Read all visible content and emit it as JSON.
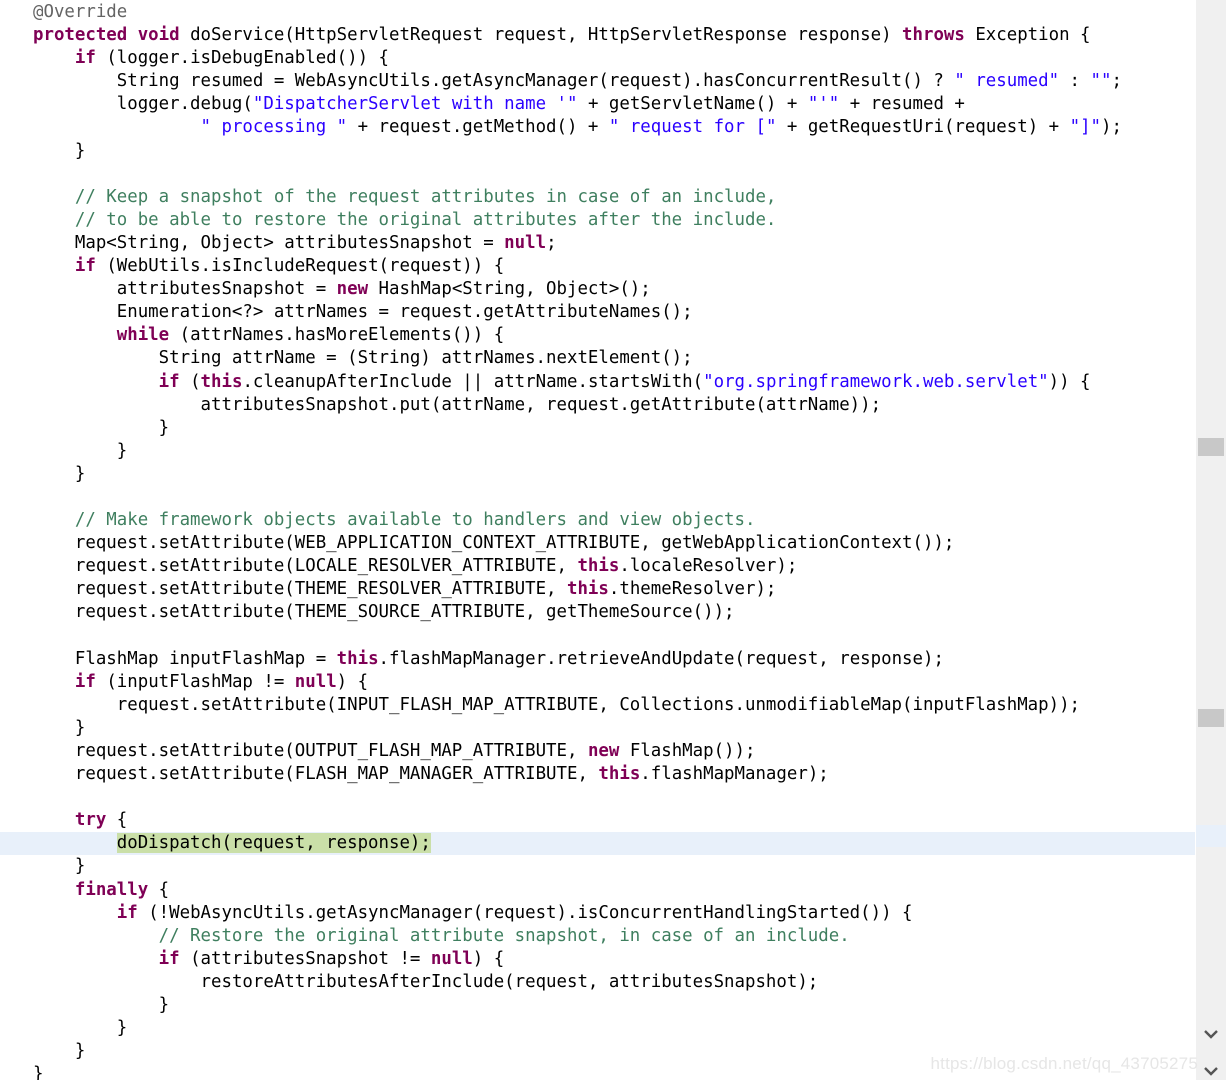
{
  "editor": {
    "language": "java",
    "colors": {
      "background": "#ffffff",
      "foreground": "#000000",
      "keyword": "#7f0055",
      "string": "#2a00ff",
      "comment": "#3f7f5f",
      "annotation": "#646464",
      "current_line_highlight": "#e8f0fa",
      "selection_highlight": "#cadfa8",
      "ruler_track": "#f0f0f0",
      "ruler_mark": "#c8c8c8",
      "watermark": "#e6e6e6"
    },
    "lines": [
      {
        "indent": 0,
        "tokens": [
          {
            "t": "@Override",
            "c": "ann"
          }
        ]
      },
      {
        "indent": 0,
        "tokens": [
          {
            "t": "protected void ",
            "c": "kw"
          },
          {
            "t": "doService(HttpServletRequest request, HttpServletResponse response) ",
            "c": "plain"
          },
          {
            "t": "throws ",
            "c": "kw"
          },
          {
            "t": "Exception {",
            "c": "plain"
          }
        ]
      },
      {
        "indent": 1,
        "tokens": [
          {
            "t": "if ",
            "c": "kw"
          },
          {
            "t": "(logger.isDebugEnabled()) {",
            "c": "plain"
          }
        ]
      },
      {
        "indent": 2,
        "tokens": [
          {
            "t": "String resumed = WebAsyncUtils.getAsyncManager(request).hasConcurrentResult() ? ",
            "c": "plain"
          },
          {
            "t": "\" resumed\"",
            "c": "str"
          },
          {
            "t": " : ",
            "c": "plain"
          },
          {
            "t": "\"\"",
            "c": "str"
          },
          {
            "t": ";",
            "c": "plain"
          }
        ]
      },
      {
        "indent": 2,
        "tokens": [
          {
            "t": "logger.debug(",
            "c": "plain"
          },
          {
            "t": "\"DispatcherServlet with name '\"",
            "c": "str"
          },
          {
            "t": " + getServletName() + ",
            "c": "plain"
          },
          {
            "t": "\"'\"",
            "c": "str"
          },
          {
            "t": " + resumed +",
            "c": "plain"
          }
        ]
      },
      {
        "indent": 4,
        "tokens": [
          {
            "t": "\" processing \"",
            "c": "str"
          },
          {
            "t": " + request.getMethod() + ",
            "c": "plain"
          },
          {
            "t": "\" request for [\"",
            "c": "str"
          },
          {
            "t": " + getRequestUri(request) + ",
            "c": "plain"
          },
          {
            "t": "\"]\"",
            "c": "str"
          },
          {
            "t": ");",
            "c": "plain"
          }
        ]
      },
      {
        "indent": 1,
        "tokens": [
          {
            "t": "}",
            "c": "plain"
          }
        ]
      },
      {
        "indent": 0,
        "tokens": []
      },
      {
        "indent": 1,
        "tokens": [
          {
            "t": "// Keep a snapshot of the request attributes in case of an include,",
            "c": "cmt"
          }
        ]
      },
      {
        "indent": 1,
        "tokens": [
          {
            "t": "// to be able to restore the original attributes after the include.",
            "c": "cmt"
          }
        ]
      },
      {
        "indent": 1,
        "tokens": [
          {
            "t": "Map<String, Object> attributesSnapshot = ",
            "c": "plain"
          },
          {
            "t": "null",
            "c": "kw"
          },
          {
            "t": ";",
            "c": "plain"
          }
        ]
      },
      {
        "indent": 1,
        "tokens": [
          {
            "t": "if ",
            "c": "kw"
          },
          {
            "t": "(WebUtils.isIncludeRequest(request)) {",
            "c": "plain"
          }
        ]
      },
      {
        "indent": 2,
        "tokens": [
          {
            "t": "attributesSnapshot = ",
            "c": "plain"
          },
          {
            "t": "new ",
            "c": "kw"
          },
          {
            "t": "HashMap<String, Object>();",
            "c": "plain"
          }
        ]
      },
      {
        "indent": 2,
        "tokens": [
          {
            "t": "Enumeration<?> attrNames = request.getAttributeNames();",
            "c": "plain"
          }
        ]
      },
      {
        "indent": 2,
        "tokens": [
          {
            "t": "while ",
            "c": "kw"
          },
          {
            "t": "(attrNames.hasMoreElements()) {",
            "c": "plain"
          }
        ]
      },
      {
        "indent": 3,
        "tokens": [
          {
            "t": "String attrName = (String) attrNames.nextElement();",
            "c": "plain"
          }
        ]
      },
      {
        "indent": 3,
        "tokens": [
          {
            "t": "if ",
            "c": "kw"
          },
          {
            "t": "(",
            "c": "plain"
          },
          {
            "t": "this",
            "c": "kw"
          },
          {
            "t": ".cleanupAfterInclude || attrName.startsWith(",
            "c": "plain"
          },
          {
            "t": "\"org.springframework.web.servlet\"",
            "c": "str"
          },
          {
            "t": ")) {",
            "c": "plain"
          }
        ]
      },
      {
        "indent": 4,
        "tokens": [
          {
            "t": "attributesSnapshot.put(attrName, request.getAttribute(attrName));",
            "c": "plain"
          }
        ]
      },
      {
        "indent": 3,
        "tokens": [
          {
            "t": "}",
            "c": "plain"
          }
        ]
      },
      {
        "indent": 2,
        "tokens": [
          {
            "t": "}",
            "c": "plain"
          }
        ]
      },
      {
        "indent": 1,
        "tokens": [
          {
            "t": "}",
            "c": "plain"
          }
        ]
      },
      {
        "indent": 0,
        "tokens": []
      },
      {
        "indent": 1,
        "tokens": [
          {
            "t": "// Make framework objects available to handlers and view objects.",
            "c": "cmt"
          }
        ]
      },
      {
        "indent": 1,
        "tokens": [
          {
            "t": "request.setAttribute(WEB_APPLICATION_CONTEXT_ATTRIBUTE, getWebApplicationContext());",
            "c": "plain"
          }
        ]
      },
      {
        "indent": 1,
        "tokens": [
          {
            "t": "request.setAttribute(LOCALE_RESOLVER_ATTRIBUTE, ",
            "c": "plain"
          },
          {
            "t": "this",
            "c": "kw"
          },
          {
            "t": ".localeResolver);",
            "c": "plain"
          }
        ]
      },
      {
        "indent": 1,
        "tokens": [
          {
            "t": "request.setAttribute(THEME_RESOLVER_ATTRIBUTE, ",
            "c": "plain"
          },
          {
            "t": "this",
            "c": "kw"
          },
          {
            "t": ".themeResolver);",
            "c": "plain"
          }
        ]
      },
      {
        "indent": 1,
        "tokens": [
          {
            "t": "request.setAttribute(THEME_SOURCE_ATTRIBUTE, getThemeSource());",
            "c": "plain"
          }
        ]
      },
      {
        "indent": 0,
        "tokens": []
      },
      {
        "indent": 1,
        "tokens": [
          {
            "t": "FlashMap inputFlashMap = ",
            "c": "plain"
          },
          {
            "t": "this",
            "c": "kw"
          },
          {
            "t": ".flashMapManager.retrieveAndUpdate(request, response);",
            "c": "plain"
          }
        ]
      },
      {
        "indent": 1,
        "tokens": [
          {
            "t": "if ",
            "c": "kw"
          },
          {
            "t": "(inputFlashMap != ",
            "c": "plain"
          },
          {
            "t": "null",
            "c": "kw"
          },
          {
            "t": ") {",
            "c": "plain"
          }
        ]
      },
      {
        "indent": 2,
        "tokens": [
          {
            "t": "request.setAttribute(INPUT_FLASH_MAP_ATTRIBUTE, Collections.unmodifiableMap(inputFlashMap));",
            "c": "plain"
          }
        ]
      },
      {
        "indent": 1,
        "tokens": [
          {
            "t": "}",
            "c": "plain"
          }
        ]
      },
      {
        "indent": 1,
        "tokens": [
          {
            "t": "request.setAttribute(OUTPUT_FLASH_MAP_ATTRIBUTE, ",
            "c": "plain"
          },
          {
            "t": "new ",
            "c": "kw"
          },
          {
            "t": "FlashMap());",
            "c": "plain"
          }
        ]
      },
      {
        "indent": 1,
        "tokens": [
          {
            "t": "request.setAttribute(FLASH_MAP_MANAGER_ATTRIBUTE, ",
            "c": "plain"
          },
          {
            "t": "this",
            "c": "kw"
          },
          {
            "t": ".flashMapManager);",
            "c": "plain"
          }
        ]
      },
      {
        "indent": 0,
        "tokens": []
      },
      {
        "indent": 1,
        "tokens": [
          {
            "t": "try ",
            "c": "kw"
          },
          {
            "t": "{",
            "c": "plain"
          }
        ]
      },
      {
        "indent": 2,
        "current": true,
        "selected": true,
        "tokens": [
          {
            "t": "doDispatch(request, response);",
            "c": "plain"
          }
        ]
      },
      {
        "indent": 1,
        "tokens": [
          {
            "t": "}",
            "c": "plain"
          }
        ]
      },
      {
        "indent": 1,
        "tokens": [
          {
            "t": "finally ",
            "c": "kw"
          },
          {
            "t": "{",
            "c": "plain"
          }
        ]
      },
      {
        "indent": 2,
        "tokens": [
          {
            "t": "if ",
            "c": "kw"
          },
          {
            "t": "(!WebAsyncUtils.getAsyncManager(request).isConcurrentHandlingStarted()) {",
            "c": "plain"
          }
        ]
      },
      {
        "indent": 3,
        "tokens": [
          {
            "t": "// Restore the original attribute snapshot, in case of an include.",
            "c": "cmt"
          }
        ]
      },
      {
        "indent": 3,
        "tokens": [
          {
            "t": "if ",
            "c": "kw"
          },
          {
            "t": "(attributesSnapshot != ",
            "c": "plain"
          },
          {
            "t": "null",
            "c": "kw"
          },
          {
            "t": ") {",
            "c": "plain"
          }
        ]
      },
      {
        "indent": 4,
        "tokens": [
          {
            "t": "restoreAttributesAfterInclude(request, attributesSnapshot);",
            "c": "plain"
          }
        ]
      },
      {
        "indent": 3,
        "tokens": [
          {
            "t": "}",
            "c": "plain"
          }
        ]
      },
      {
        "indent": 2,
        "tokens": [
          {
            "t": "}",
            "c": "plain"
          }
        ]
      },
      {
        "indent": 1,
        "tokens": [
          {
            "t": "}",
            "c": "plain"
          }
        ]
      },
      {
        "indent": 0,
        "tokens": [
          {
            "t": "}",
            "c": "plain"
          }
        ]
      }
    ]
  },
  "overview_ruler": {
    "marks": [
      {
        "name": "ruler-mark-1"
      },
      {
        "name": "ruler-mark-2"
      }
    ],
    "chevrons": [
      "chevron-down-icon",
      "chevron-down-icon"
    ]
  },
  "watermark": {
    "text": "https://blog.csdn.net/qq_43705275"
  }
}
